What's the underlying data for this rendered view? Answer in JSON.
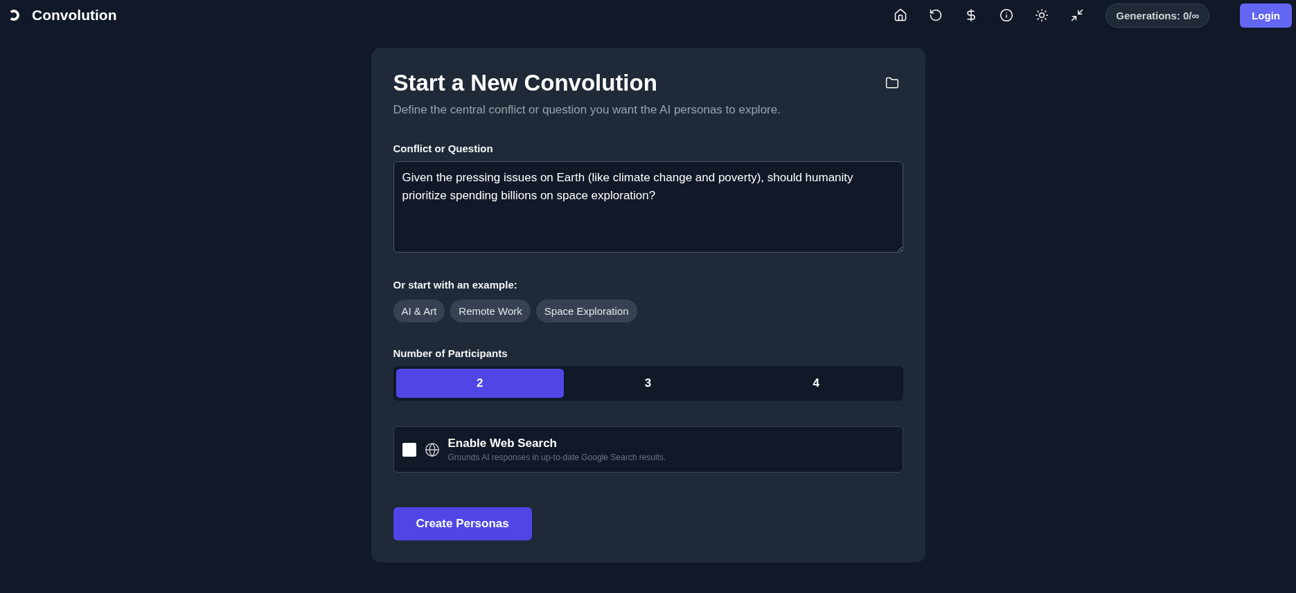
{
  "header": {
    "app_name": "Convolution",
    "actions": [
      {
        "kind": "home"
      },
      {
        "kind": "reset"
      },
      {
        "kind": "pricing"
      },
      {
        "kind": "info"
      },
      {
        "kind": "theme"
      },
      {
        "kind": "collapse"
      }
    ],
    "generations": "Generations: 0/∞",
    "login": "Login"
  },
  "card": {
    "title": "Start a New Convolution",
    "subtitle": "Define the central conflict or question you want the AI personas to explore.",
    "question_label": "Conflict or Question",
    "question_value": "Given the pressing issues on Earth (like climate change and poverty), should humanity prioritize spending billions on space exploration?",
    "examples_label": "Or start with an example:",
    "examples": [
      "AI & Art",
      "Remote Work",
      "Space Exploration"
    ],
    "participants_label": "Number of Participants",
    "participants": [
      {
        "label": "2",
        "selected": true
      },
      {
        "label": "3",
        "selected": false
      },
      {
        "label": "4",
        "selected": false
      }
    ],
    "web_search": {
      "title": "Enable Web Search",
      "description": "Grounds AI responses in up-to-date Google Search results.",
      "checked": false
    },
    "submit": "Create Personas"
  }
}
